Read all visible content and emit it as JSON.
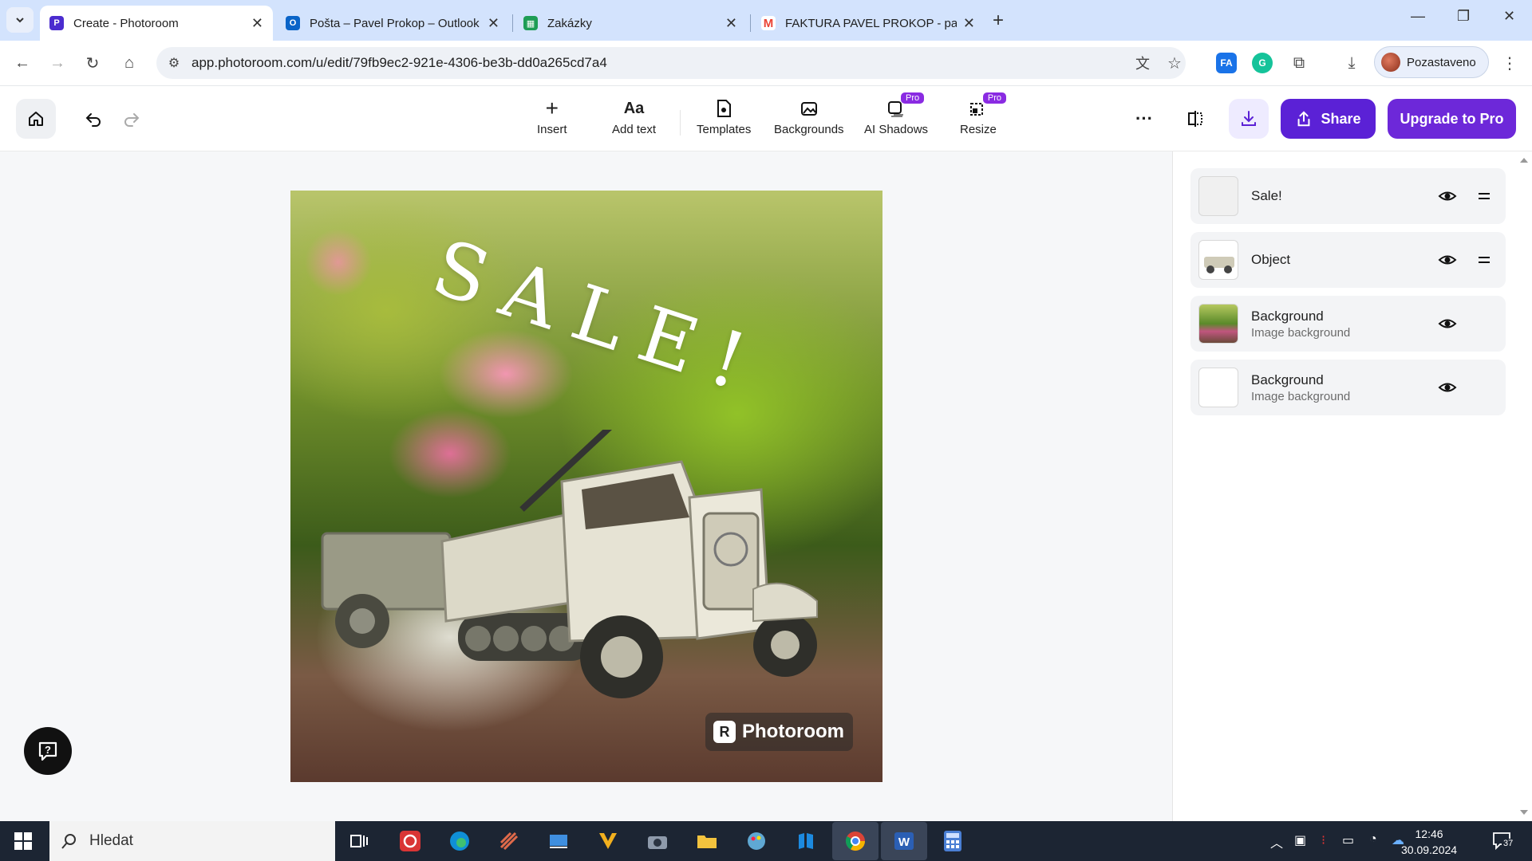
{
  "browser": {
    "tabs": [
      {
        "title": "Create - Photoroom",
        "favicon": "photoroom-icon",
        "color": "#4b2ccf"
      },
      {
        "title": "Pošta – Pavel Prokop – Outlook",
        "favicon": "outlook-icon",
        "color": "#0a64c8"
      },
      {
        "title": "Zakázky",
        "favicon": "sheets-icon",
        "color": "#1e9d55"
      },
      {
        "title": "FAKTURA PAVEL PROKOP - pav",
        "favicon": "gmail-icon",
        "color": "#ea4335"
      }
    ],
    "url": "app.photoroom.com/u/edit/79fb9ec2-921e-4306-be3b-dd0a265cd7a4",
    "profile_label": "Pozastaveno",
    "extension_fa": "FA"
  },
  "toolbar": {
    "insert": "Insert",
    "add_text": "Add text",
    "add_text_icon": "Aa",
    "templates": "Templates",
    "backgrounds": "Backgrounds",
    "ai_shadows": "AI Shadows",
    "resize": "Resize",
    "pro_badge": "Pro",
    "share": "Share",
    "upgrade": "Upgrade to Pro"
  },
  "canvas": {
    "text_layer": "SALE!",
    "watermark": "Photoroom"
  },
  "layers": [
    {
      "name": "Sale!",
      "subtitle": ""
    },
    {
      "name": "Object",
      "subtitle": ""
    },
    {
      "name": "Background",
      "subtitle": "Image background"
    },
    {
      "name": "Background",
      "subtitle": "Image background"
    }
  ],
  "taskbar": {
    "search_placeholder": "Hledat",
    "time": "12:46",
    "date": "30.09.2024",
    "notification_count": "37"
  },
  "colors": {
    "brand": "#5b21d6",
    "upgrade": "#6d28d9",
    "pro_badge": "#8a2be2"
  }
}
